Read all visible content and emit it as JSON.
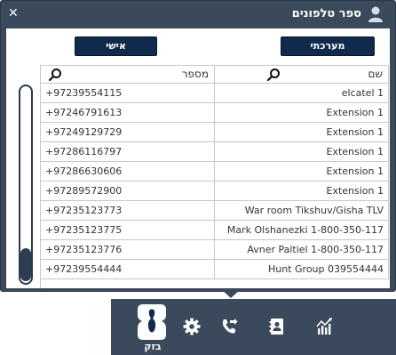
{
  "window": {
    "title": "ספר טלפונים",
    "close_glyph": "✕"
  },
  "buttons": {
    "personal": "אישי",
    "system": "מערכתי"
  },
  "table": {
    "columns": {
      "phone": "מספר",
      "name": "שם"
    },
    "rows": [
      {
        "phone": "+97239554115",
        "name": "elcatel 1"
      },
      {
        "phone": "+97246791613",
        "name": "Extension 1"
      },
      {
        "phone": "+97249129729",
        "name": "Extension 1"
      },
      {
        "phone": "+97286116797",
        "name": "Extension 1"
      },
      {
        "phone": "+97286630606",
        "name": "Extension 1"
      },
      {
        "phone": "+97289572900",
        "name": "Extension 1"
      },
      {
        "phone": "+97235123773",
        "name": "War room Tikshuv/Gisha TLV"
      },
      {
        "phone": "+97235123775",
        "name": "Mark Olshanezki 1-800-350-117"
      },
      {
        "phone": "+97235123776",
        "name": "Avner Paltiel 1-800-350-117"
      },
      {
        "phone": "+97239554444",
        "name": "Hunt Group 039554444"
      }
    ]
  },
  "toolbar": {
    "logo_label": "בזק",
    "icons": [
      "settings-icon",
      "call-forward-icon",
      "phonebook-icon",
      "statistics-icon"
    ]
  },
  "colors": {
    "panel": "#3a4a5c",
    "button": "#0f2a4a",
    "grid_line": "#c8c8c8"
  }
}
